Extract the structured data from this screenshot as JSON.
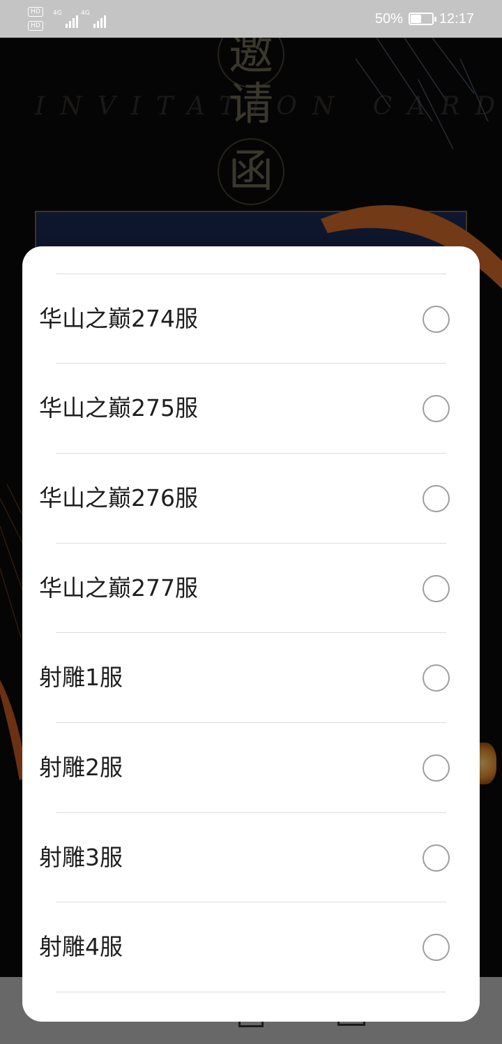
{
  "status_bar": {
    "battery_percent": "50%",
    "battery_level": 0.5,
    "time": "12:17",
    "network_1": "4G",
    "network_2": "4G",
    "hd_badge_1": "HD",
    "hd_badge_2": "HD"
  },
  "background": {
    "title_chars": [
      "邀",
      "请",
      "函"
    ],
    "subtitle_en": "INVITATION CARD"
  },
  "dialog": {
    "options": [
      {
        "label": "华山之巅274服",
        "selected": false
      },
      {
        "label": "华山之巅275服",
        "selected": false
      },
      {
        "label": "华山之巅276服",
        "selected": false
      },
      {
        "label": "华山之巅277服",
        "selected": false
      },
      {
        "label": "射雕1服",
        "selected": false
      },
      {
        "label": "射雕2服",
        "selected": false
      },
      {
        "label": "射雕3服",
        "selected": false
      },
      {
        "label": "射雕4服",
        "selected": false
      }
    ]
  },
  "colors": {
    "dialog_bg": "#ffffff",
    "radio_border": "#9e9e9e",
    "divider": "#dcdcdc",
    "ribbon": "#d06a2a"
  }
}
